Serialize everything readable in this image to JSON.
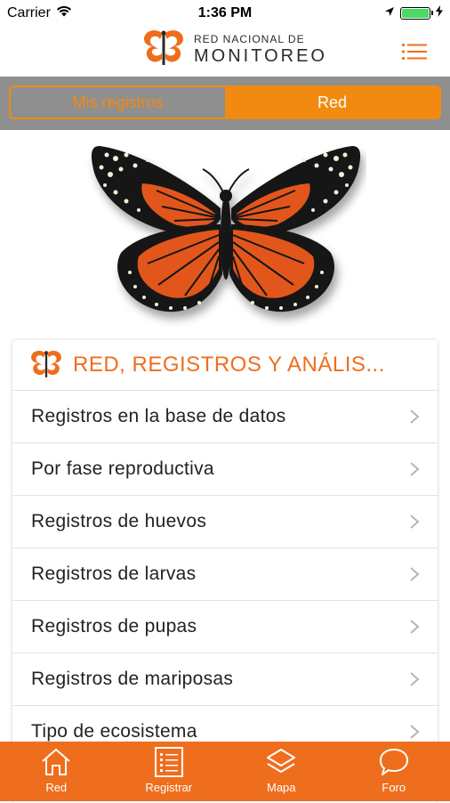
{
  "status_bar": {
    "carrier": "Carrier",
    "time": "1:36 PM",
    "battery_level": 1.0,
    "icons": [
      "wifi-icon",
      "location-arrow-icon",
      "battery-icon",
      "charging-bolt-icon"
    ]
  },
  "header": {
    "logo_line1": "RED NACIONAL DE",
    "logo_line2": "MONITOREO",
    "menu_icon": "list-menu-icon"
  },
  "segments": {
    "mis_registros": "Mis registros",
    "red": "Red",
    "selected": "Red"
  },
  "hero": {
    "image": "monarch-butterfly"
  },
  "card": {
    "title": "RED, REGISTROS Y ANÁLIS...",
    "items": [
      {
        "label": "Registros en la base de datos"
      },
      {
        "label": "Por fase reproductiva"
      },
      {
        "label": "Registros de huevos"
      },
      {
        "label": "Registros de larvas"
      },
      {
        "label": "Registros de pupas"
      },
      {
        "label": "Registros de mariposas"
      },
      {
        "label": "Tipo de ecosistema"
      }
    ]
  },
  "tab_bar": {
    "tabs": [
      {
        "label": "Red",
        "icon": "home-icon"
      },
      {
        "label": "Registrar",
        "icon": "list-form-icon"
      },
      {
        "label": "Mapa",
        "icon": "layers-icon"
      },
      {
        "label": "Foro",
        "icon": "chat-bubble-icon"
      }
    ]
  },
  "colors": {
    "accent": "#ee6e1d",
    "segment_orange": "#f28a12",
    "segment_background": "#8f8f8f",
    "battery_green": "#4cd964"
  }
}
